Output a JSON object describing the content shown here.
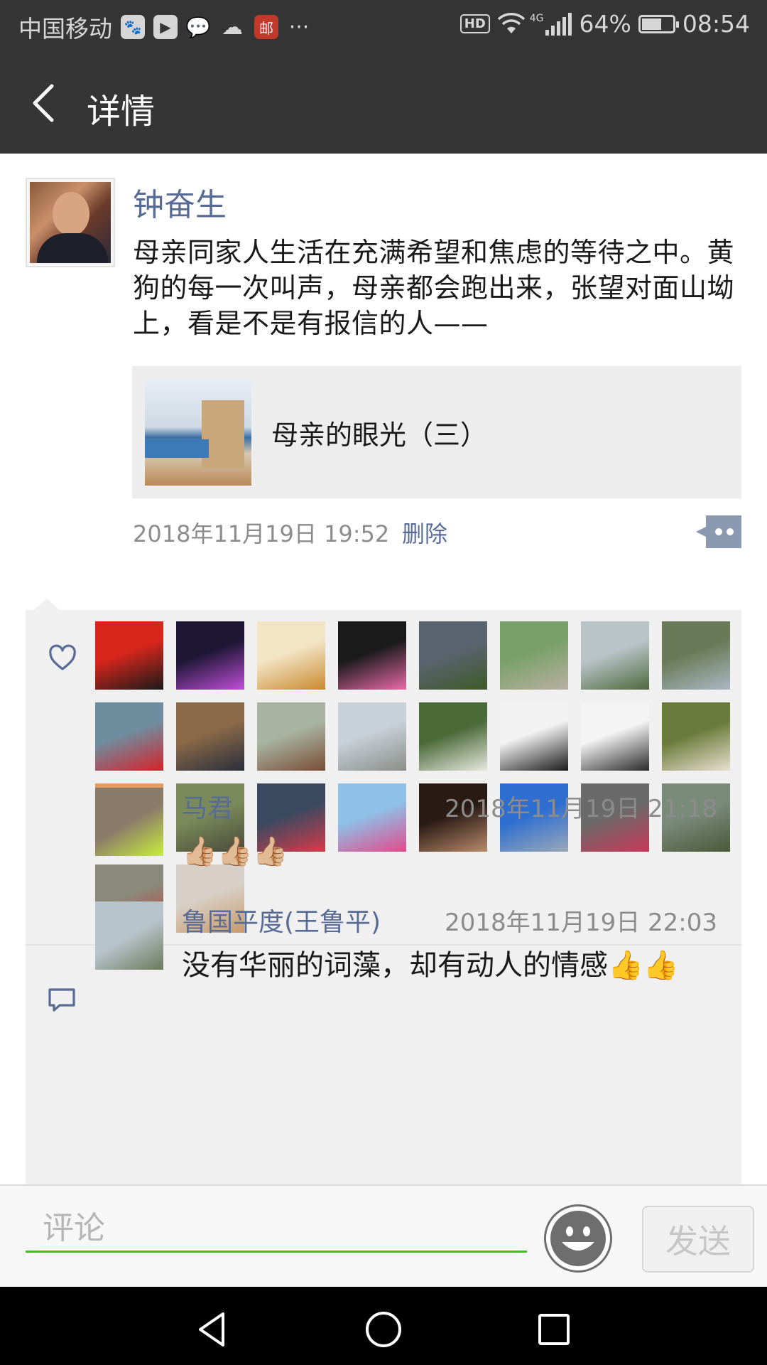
{
  "status_bar": {
    "carrier": "中国移动",
    "app_icons": [
      "baidu-icon",
      "video-icon",
      "wechat-icon",
      "cloud-icon",
      "post-icon"
    ],
    "more": "···",
    "hd": "HD",
    "network": "4G",
    "battery": "64%",
    "battery_level": 0.64,
    "time": "08:54"
  },
  "header": {
    "title": "详情"
  },
  "post": {
    "author": "钟奋生",
    "text": "母亲同家人生活在充满希望和焦虑的等待之中。黄狗的每一次叫声，母亲都会跑出来，张望对面山坳上，看是不是有报信的人——",
    "link_title": "母亲的眼光（三）",
    "time": "2018年11月19日 19:52",
    "delete_label": "删除"
  },
  "likes": {
    "avatars": [
      {
        "color": "#d8261c",
        "accent": "#1a1a1a"
      },
      {
        "color": "#1d1635",
        "accent": "#c04fd8"
      },
      {
        "color": "#f3e4c6",
        "accent": "#c98a2e"
      },
      {
        "color": "#1a1a1a",
        "accent": "#e96aa8"
      },
      {
        "color": "#5a6470",
        "accent": "#3e5a2a"
      },
      {
        "color": "#7aa06a",
        "accent": "#b8b0a0"
      },
      {
        "color": "#b9c4c8",
        "accent": "#4d6a3e"
      },
      {
        "color": "#6a7a58",
        "accent": "#a8b8c4"
      },
      {
        "color": "#6e8ea0",
        "accent": "#d6222a"
      },
      {
        "color": "#8a6a48",
        "accent": "#2a2e3c"
      },
      {
        "color": "#a8b4a0",
        "accent": "#7a4e36"
      },
      {
        "color": "#c8d0d8",
        "accent": "#8a8e88"
      },
      {
        "color": "#4a6a38",
        "accent": "#e8e8e0"
      },
      {
        "color": "#f2f2f2",
        "accent": "#1a1a1a"
      },
      {
        "color": "#f4f4f4",
        "accent": "#2a2a2a"
      },
      {
        "color": "#6a7a3a",
        "accent": "#e8e0d0"
      },
      {
        "color": "#e89a5a",
        "accent": "#3a4a6a"
      },
      {
        "color": "#7a8a5a",
        "accent": "#4a4a3a"
      },
      {
        "color": "#3a4a60",
        "accent": "#d83a4a"
      },
      {
        "color": "#8ec0e8",
        "accent": "#e24a8a"
      },
      {
        "color": "#2a1a14",
        "accent": "#b88a6a"
      },
      {
        "color": "#2e6ed0",
        "accent": "#9aa8b8"
      },
      {
        "color": "#6a6a6a",
        "accent": "#c8385a"
      },
      {
        "color": "#7a8a7a",
        "accent": "#4a5a3a"
      },
      {
        "color": "#8a8a7a",
        "accent": "#c8383a"
      },
      {
        "color": "#d8d0c8",
        "accent": "#c89a6a"
      }
    ]
  },
  "comments": [
    {
      "name": "马君",
      "time": "2018年11月19日 21:18",
      "text": "👍🏼👍🏼👍🏼",
      "avatar_color": "#8a7a6a",
      "avatar_accent": "#c8ee3a"
    },
    {
      "name": "鲁国平度(王鲁平)",
      "time": "2018年11月19日 22:03",
      "text": "没有华丽的词藻，却有动人的情感👍👍",
      "avatar_color": "#b8c4cc",
      "avatar_accent": "#6a7a5a"
    }
  ],
  "input": {
    "placeholder": "评论",
    "send_label": "发送"
  },
  "nav": [
    "back-icon",
    "home-icon",
    "recents-icon"
  ]
}
